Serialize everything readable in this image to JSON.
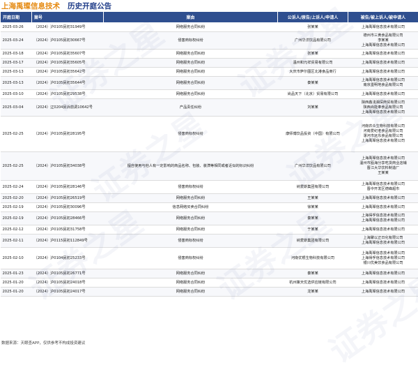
{
  "header": {
    "company": "上海禹璨信息技术",
    "subtitle": "历史开庭公告"
  },
  "table": {
    "columns": [
      "开庭日期",
      "案号",
      "案由",
      "公诉人/原告/上诉人/申请人",
      "被告/被上诉人/被申请人"
    ],
    "rows": [
      {
        "date": "2025-03-26",
        "case_no": "（2024）沪0105民初31949号",
        "cause": "网络服务合同纠纷",
        "plaintiff": [
          "张某某"
        ],
        "defendant": [
          "上海禹璨信息技术有限公司"
        ]
      },
      {
        "date": "2025-03-24",
        "case_no": "（2024）沪0105民初30667号",
        "cause": "侵害商标权纠纷",
        "plaintiff": [
          "广州华洋饮品有限公司"
        ],
        "defendant": [
          "德州市三黄食品有限公司",
          "李某某",
          "上海禹璨信息技术有限公司"
        ]
      },
      {
        "date": "2025-03-18",
        "case_no": "（2024）沪0105民初35607号",
        "cause": "网络服务合同纠纷",
        "plaintiff": [
          "张某某"
        ],
        "defendant": [
          "上海禹璨信息技术有限公司"
        ]
      },
      {
        "date": "2025-03-17",
        "case_no": "（2024）沪0105民初35605号",
        "cause": "网络服务合同纠纷",
        "plaintiff": [
          "温州和元祥贸易有限公司"
        ],
        "defendant": [
          "上海禹璨信息技术有限公司"
        ]
      },
      {
        "date": "2025-03-13",
        "case_no": "（2024）沪0105民初35642号",
        "cause": "网络服务合同纠纷",
        "plaintiff": [
          "大庆市萨尔图区北港食品商行"
        ],
        "defendant": [
          "上海禹璨信息技术有限公司"
        ]
      },
      {
        "date": "2025-03-13",
        "case_no": "（2024）沪0105民初35644号",
        "cause": "网络服务合同纠纷",
        "plaintiff": [
          "秦某某"
        ],
        "defendant": [
          "上海禹璨信息技术有限公司",
          "南京墨明地食品有限公司"
        ]
      },
      {
        "date": "2025-03-10",
        "case_no": "（2024）沪0105民初29538号",
        "cause": "网络服务合同纠纷",
        "plaintiff": [
          "尚品天下（北京）贸易有限公司"
        ],
        "defendant": [
          "上海禹璨信息技术有限公司"
        ]
      },
      {
        "date": "2025-03-04",
        "case_no": "（2024）辽0204民诉前调10642号",
        "cause": "产品责任纠纷",
        "plaintiff": [
          "刘某某"
        ],
        "defendant": [
          "陕西鑫浅湘深商贸有限公司",
          "陕西尚能奉食品有限公司",
          "上海禹璨信息技术有限公司"
        ]
      },
      {
        "date": "2025-02-25",
        "case_no": "（2024）沪0105民初28195号",
        "cause": "侵害商标权纠纷",
        "plaintiff": [
          "康师傅饮品投资（中国）有限公司"
        ],
        "defendant": [
          "河南农众生物科技有限公司",
          "河南爱纪老食品有限公司",
          "漯河市远东食品有限公司",
          "上海禹璨信息技术有限公司"
        ]
      },
      {
        "date": "2025-02-25",
        "case_no": "（2024）沪0105民初34038号",
        "cause": "擅自使用与他人有一定影响的商品名称、包装、装潢等相同或者近似的标识纠纷",
        "plaintiff": [
          "广州华洋饮品有限公司"
        ],
        "defendant": [
          "上海禹璨信息技术有限公司",
          "温州市瓯海分享吃货商业店铺",
          "晋江大华饮料制造厂",
          "王某某"
        ]
      },
      {
        "date": "2025-02-24",
        "case_no": "（2024）沪0105民初28146号",
        "cause": "侵害商标权纠纷",
        "plaintiff": [
          "纳爱斯集团有限公司"
        ],
        "defendant": [
          "上海禹璨信息技术有限公司",
          "晋中开发区德峰超市"
        ]
      },
      {
        "date": "2025-02-20",
        "case_no": "（2024）沪0105民初26519号",
        "cause": "网络服务合同纠纷",
        "plaintiff": [
          "王某某"
        ],
        "defendant": [
          "上海禹璨信息技术有限公司"
        ]
      },
      {
        "date": "2025-02-19",
        "case_no": "（2024）沪0105民初30096号",
        "cause": "信息网络买卖合同纠纷",
        "plaintiff": [
          "徐某某"
        ],
        "defendant": [
          "上海禹璨信息技术有限公司"
        ]
      },
      {
        "date": "2025-02-19",
        "case_no": "（2024）沪0105民初28466号",
        "cause": "网络服务合同纠纷",
        "plaintiff": [
          "秦某某"
        ],
        "defendant": [
          "上海得孚信息技术有限公司",
          "上海禹璨信息技术有限公司"
        ]
      },
      {
        "date": "2025-02-12",
        "case_no": "（2024）沪0105民初31758号",
        "cause": "网络服务合同纠纷",
        "plaintiff": [
          "于某某"
        ],
        "defendant": [
          "上海禹璨信息技术有限公司"
        ]
      },
      {
        "date": "2025-02-11",
        "case_no": "（2024）沪0115民初112849号",
        "cause": "侵害商标权纠纷",
        "plaintiff": [
          "纳爱斯集团有限公司"
        ],
        "defendant": [
          "上海聚以正日化有限公司",
          "上海禹璨信息技术有限公司"
        ]
      },
      {
        "date": "2025-02-10",
        "case_no": "（2024）沪0104民初25233号",
        "cause": "侵害商标权纠纷",
        "plaintiff": [
          "河南优根生物科技有限公司"
        ],
        "defendant": [
          "上海禹璨信息技术有限公司",
          "上海得孚信息技术有限公司",
          "银川优美饮食品有限公司"
        ]
      },
      {
        "date": "2025-01-23",
        "case_no": "（2024）沪0105民初26771号",
        "cause": "网络服务合同纠纷",
        "plaintiff": [
          "秦某某"
        ],
        "defendant": [
          "上海禹璨信息技术有限公司"
        ]
      },
      {
        "date": "2025-01-20",
        "case_no": "（2024）沪0105民初24018号",
        "cause": "网络服务合同纠纷",
        "plaintiff": [
          "杭州策天优选供应链有限公司"
        ],
        "defendant": [
          "上海禹璨信息技术有限公司"
        ]
      },
      {
        "date": "2025-01-20",
        "case_no": "（2024）沪0105民初24017号",
        "cause": "网络服务合同纠纷",
        "plaintiff": [
          "龙某某"
        ],
        "defendant": [
          "上海禹璨信息技术有限公司"
        ]
      }
    ]
  },
  "footer": "数据来源：天眼查APP，仅供参考不构成投资建议",
  "watermark_text": "证券之星",
  "colors": {
    "header_bg": "#2f4f8f",
    "title_company": "#e58a12",
    "title_sub": "#1f3c88"
  }
}
